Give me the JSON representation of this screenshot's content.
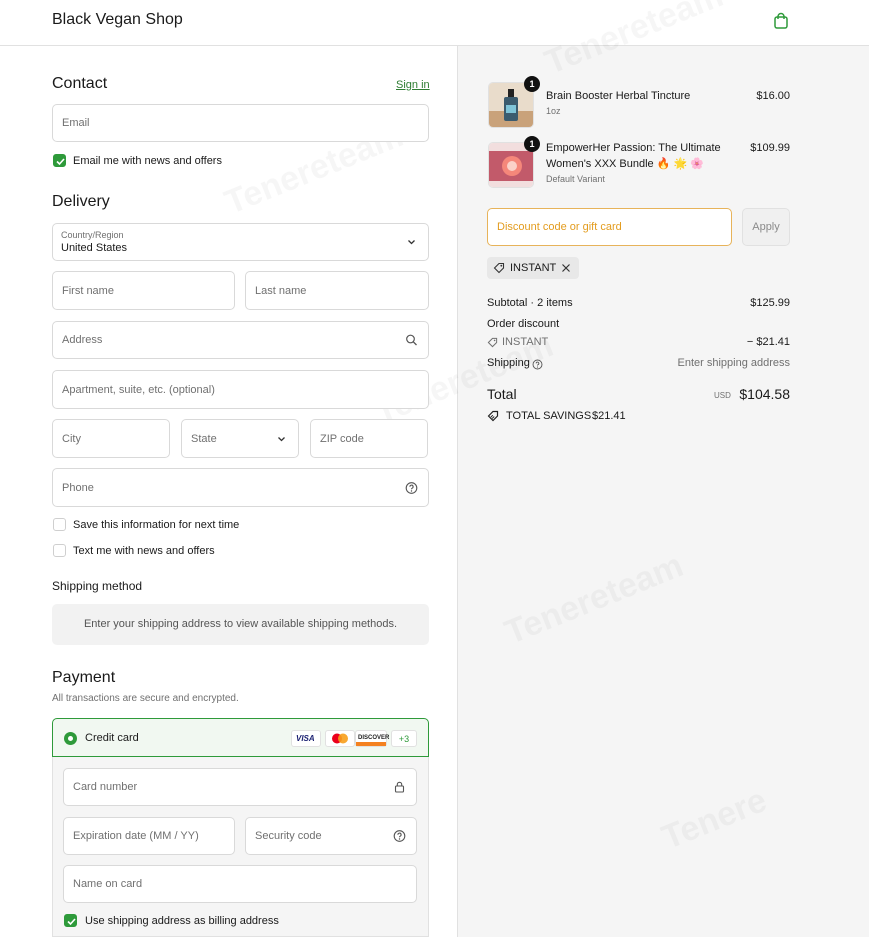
{
  "header": {
    "shop_name": "Black Vegan Shop"
  },
  "contact": {
    "heading": "Contact",
    "sign_in": "Sign in",
    "email_placeholder": "Email",
    "email_news_label": "Email me with news and offers"
  },
  "delivery": {
    "heading": "Delivery",
    "country_label": "Country/Region",
    "country_value": "United States",
    "first_name": "First name",
    "last_name": "Last name",
    "address": "Address",
    "apartment": "Apartment, suite, etc. (optional)",
    "city": "City",
    "state": "State",
    "zip": "ZIP code",
    "phone": "Phone",
    "save_info_label": "Save this information for next time",
    "text_news_label": "Text me with news and offers"
  },
  "shipping_method": {
    "heading": "Shipping method",
    "message": "Enter your shipping address to view available shipping methods."
  },
  "payment": {
    "heading": "Payment",
    "subtitle": "All transactions are secure and encrypted.",
    "credit_card_label": "Credit card",
    "card_brands": [
      "VISA",
      "Mastercard",
      "DISCOVER"
    ],
    "more_brands": "+3",
    "card_number": "Card number",
    "expiration": "Expiration date (MM / YY)",
    "security_code": "Security code",
    "name_on_card": "Name on card",
    "billing_same_label": "Use shipping address as billing address"
  },
  "order": {
    "items": [
      {
        "qty": "1",
        "name": "Brain Booster Herbal Tincture",
        "variant": "1oz",
        "price": "$16.00"
      },
      {
        "qty": "1",
        "name_line1": "EmpowerHer Passion: The Ultimate",
        "name_line2": "Women's XXX Bundle 🔥 🌟 🌸",
        "variant": "Default Variant",
        "price": "$109.99"
      }
    ],
    "discount_placeholder": "Discount code or gift card",
    "apply_label": "Apply",
    "applied_code": "INSTANT",
    "subtotal_label": "Subtotal · 2 items",
    "subtotal_value": "$125.99",
    "order_discount_label": "Order discount",
    "discount_code": "INSTANT",
    "discount_value": "− $21.41",
    "shipping_label": "Shipping",
    "shipping_value": "Enter shipping address",
    "total_label": "Total",
    "currency": "USD",
    "total_value": "$104.58",
    "savings_label": "TOTAL SAVINGS",
    "savings_value": "$21.41"
  },
  "colors": {
    "accent": "#2e9a3a",
    "discount_border": "#e7b35a",
    "discount_text": "#e39c1e"
  },
  "icons": [
    "bag-icon",
    "search-icon",
    "help-circle-icon",
    "chevron-down-icon",
    "lock-icon",
    "tag-icon",
    "close-icon",
    "check-icon"
  ]
}
